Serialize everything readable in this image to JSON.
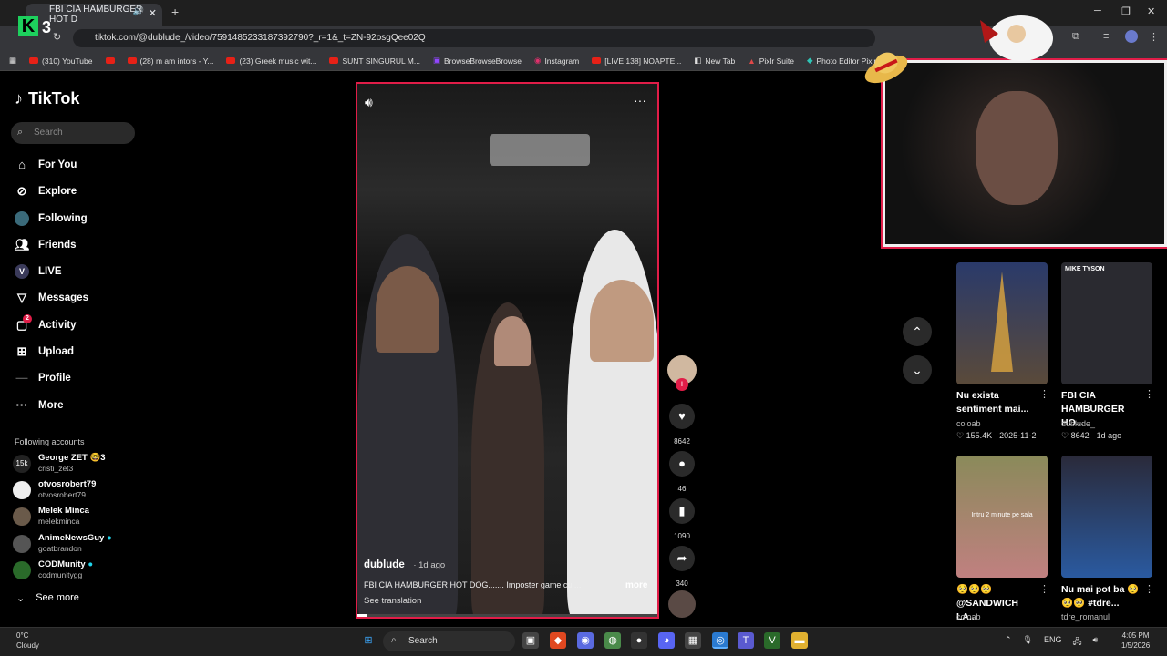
{
  "browser": {
    "tab_title": "FBI CIA HAMBURGER HOT D",
    "url": "tiktok.com/@dublude_/video/7591485233187392790?_r=1&_t=ZN-92osgQee02Q",
    "bookmarks": [
      "(310) YouTube",
      "(28) m am intors - Y...",
      "(23) Greek music wit...",
      "SUNT SINGURUL M...",
      "BrowseBrowseBrowse",
      "Instagram",
      "[LIVE 138] NOAPTE...",
      "New Tab",
      "Pixlr Suite",
      "Photo Editor Pixlr"
    ]
  },
  "overlay": {
    "brand_digit": "3"
  },
  "tiktok": {
    "logo": "TikTok",
    "search_placeholder": "Search",
    "nav": [
      {
        "label": "For You",
        "icon": "home-icon"
      },
      {
        "label": "Explore",
        "icon": "compass-icon"
      },
      {
        "label": "Following",
        "icon": "following-icon"
      },
      {
        "label": "Friends",
        "icon": "friends-icon"
      },
      {
        "label": "LIVE",
        "icon": "live-icon"
      },
      {
        "label": "Messages",
        "icon": "messages-icon"
      },
      {
        "label": "Activity",
        "icon": "activity-icon",
        "badge": "2"
      },
      {
        "label": "Upload",
        "icon": "upload-icon"
      },
      {
        "label": "Profile",
        "icon": "profile-icon"
      },
      {
        "label": "More",
        "icon": "more-icon"
      }
    ],
    "following_header": "Following accounts",
    "accounts": [
      {
        "name": "George ZET 🤓3",
        "handle": "cristi_zet3",
        "avatar": "15k"
      },
      {
        "name": "otvosrobert79",
        "handle": "otvosrobert79",
        "avatar": ""
      },
      {
        "name": "Melek Minca",
        "handle": "melekminca",
        "avatar": ""
      },
      {
        "name": "AnimeNewsGuy",
        "handle": "goatbrandon",
        "avatar": ""
      },
      {
        "name": "CODMunity",
        "handle": "codmunitygg",
        "avatar": ""
      }
    ],
    "see_more": "See more"
  },
  "video": {
    "author": "dublude_",
    "time": "· 1d ago",
    "caption": "FBI CIA HAMBURGER HOT DOG....... Imposter game cu ...",
    "more": "more",
    "see_translation": "See translation",
    "likes": "8642",
    "comments": "46",
    "saves": "1090",
    "shares": "340"
  },
  "related": [
    {
      "title": "Nu exista sentiment mai...",
      "author": "coloab",
      "meta": "♡ 155.4K · 2025-11-2",
      "thumb_color": "#3a4a6a",
      "overlay": ""
    },
    {
      "title": "FBI CIA HAMBURGER HO...",
      "author": "dublude_",
      "meta": "♡ 8642 · 1d ago",
      "thumb_color": "#2a2a30",
      "overlay": "MIKE TYSON"
    },
    {
      "title": "🥺🥺🥺 @SANDWICH LA...",
      "author": "coloab",
      "meta": "",
      "thumb_color": "#8a8a5a",
      "overlay": "Intru 2 minute pe sala"
    },
    {
      "title": "Nu mai pot ba 🥺🥺🥺 #tdre...",
      "author": "tdre_romanul",
      "meta": "",
      "thumb_color": "#2a3a6a",
      "overlay": ""
    }
  ],
  "taskbar": {
    "weather_temp": "0°C",
    "weather_desc": "Cloudy",
    "search": "Search",
    "lang": "ENG",
    "time": "4:05 PM",
    "date": "1/5/2026"
  }
}
